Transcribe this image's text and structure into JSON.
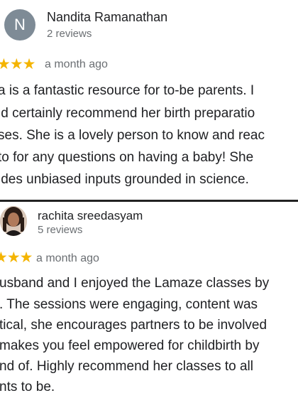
{
  "reviews": [
    {
      "avatar_letter": "N",
      "name": "Nandita Ramanathan",
      "review_count": "2 reviews",
      "stars": "★★★",
      "time": "a month ago",
      "lines": [
        "a is a fantastic resource for to-be parents. I",
        "ld certainly recommend her birth preparatio",
        "ses. She is a lovely person to know and reac",
        "to for any questions on having a baby! She",
        "ides unbiased inputs grounded in science."
      ]
    },
    {
      "name": "rachita sreedasyam",
      "review_count": "5 reviews",
      "stars": "★★★",
      "time": "a month ago",
      "lines": [
        "usband and I enjoyed the Lamaze classes by",
        ". The sessions were engaging, content was",
        "tical, she encourages partners to be involved",
        "makes you feel empowered for childbirth by",
        "nd of. Highly recommend her classes to all",
        "nts to be."
      ]
    }
  ],
  "colors": {
    "star": "#f4b400",
    "avatar_bg": "#7e8b96",
    "muted_text": "#6b6f73"
  }
}
